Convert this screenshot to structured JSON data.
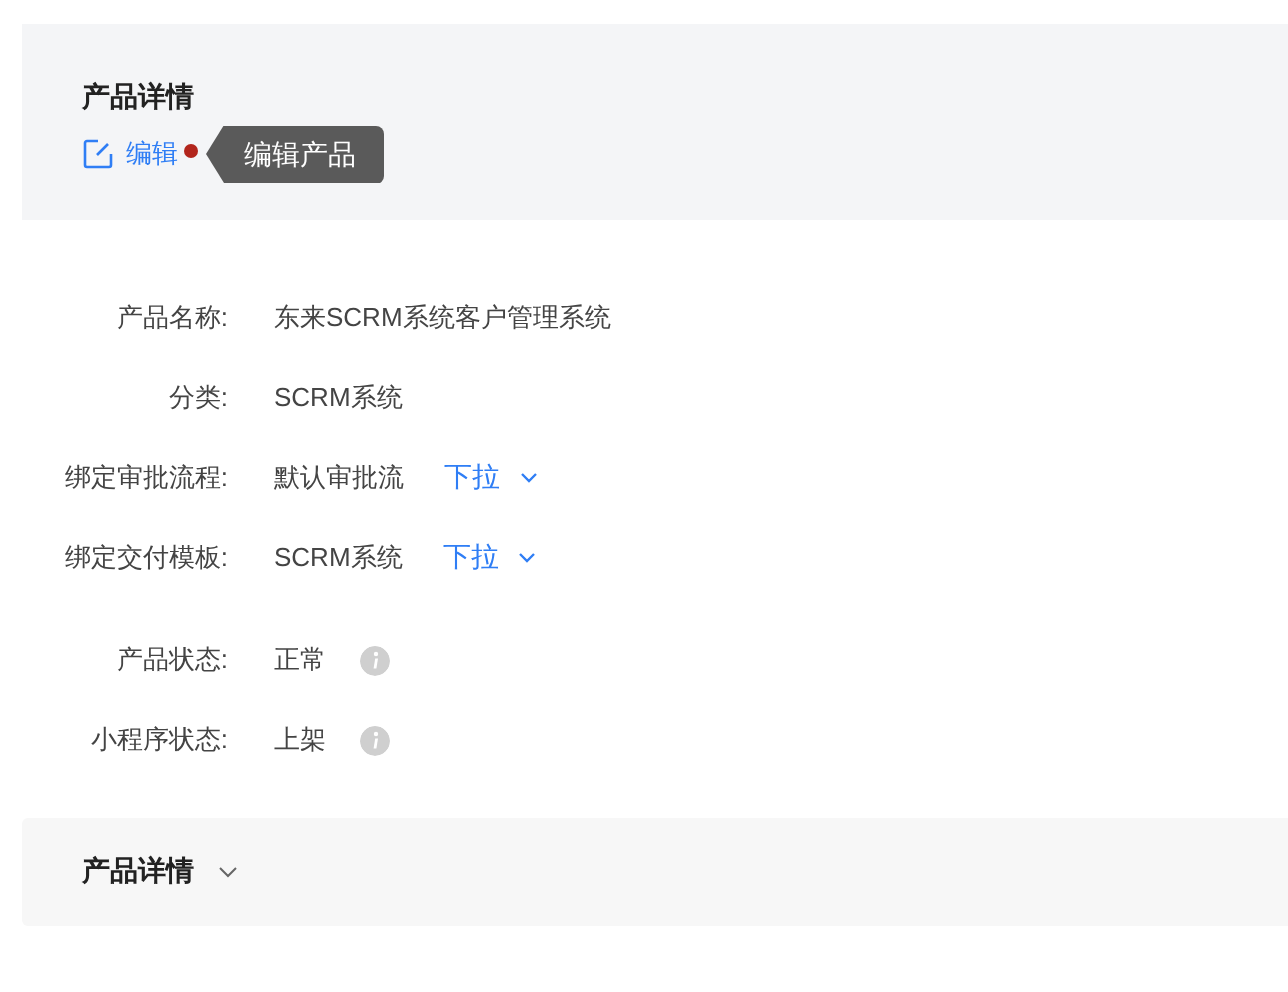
{
  "header": {
    "title": "产品详情",
    "edit_link": "编辑",
    "tooltip": "编辑产品"
  },
  "fields": [
    {
      "kind": "plain",
      "label": "产品名称:",
      "value": "东来SCRM系统客户管理系统"
    },
    {
      "kind": "plain",
      "label": "分类:",
      "value": "SCRM系统"
    },
    {
      "kind": "dropdown",
      "label": "绑定审批流程:",
      "value": "默认审批流",
      "action": "下拉"
    },
    {
      "kind": "dropdown",
      "label": "绑定交付模板:",
      "value": "SCRM系统",
      "action": "下拉"
    },
    {
      "kind": "info",
      "label": "产品状态:",
      "value": "正常"
    },
    {
      "kind": "info",
      "label": "小程序状态:",
      "value": "上架"
    }
  ],
  "section": {
    "title": "产品详情",
    "expanded": false
  }
}
